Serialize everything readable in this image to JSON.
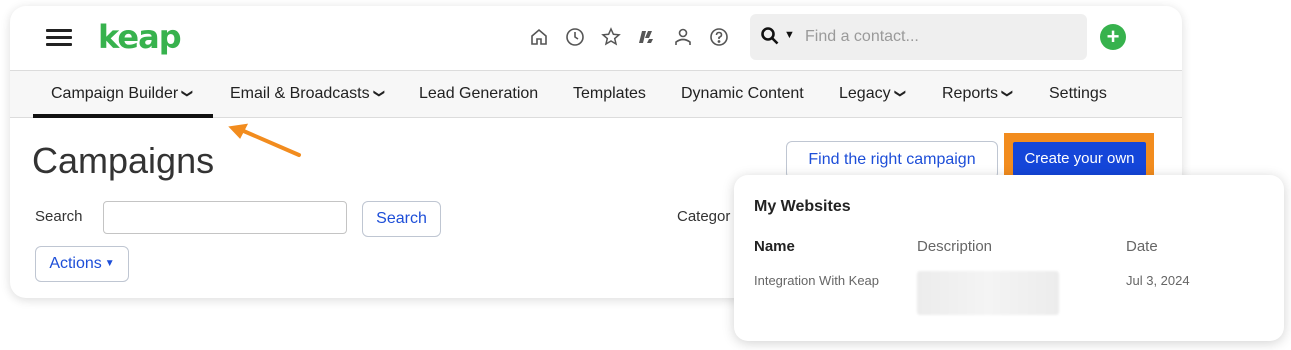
{
  "header": {
    "logo": "keap",
    "icons": [
      "home-icon",
      "clock-icon",
      "star-icon",
      "keap-mark-icon",
      "person-icon",
      "help-icon"
    ],
    "search_placeholder": "Find a contact...",
    "add_label": "+"
  },
  "nav": {
    "items": [
      {
        "label": "Campaign Builder",
        "dropdown": true,
        "active": true
      },
      {
        "label": "Email & Broadcasts",
        "dropdown": true
      },
      {
        "label": "Lead Generation",
        "dropdown": false
      },
      {
        "label": "Templates",
        "dropdown": false
      },
      {
        "label": "Dynamic Content",
        "dropdown": false
      },
      {
        "label": "Legacy",
        "dropdown": true
      },
      {
        "label": "Reports",
        "dropdown": true
      },
      {
        "label": "Settings",
        "dropdown": false
      }
    ]
  },
  "main": {
    "title": "Campaigns",
    "find_button": "Find the right campaign",
    "create_button": "Create your own",
    "search_label": "Search",
    "search_button": "Search",
    "category_label": "Categor",
    "actions_button": "Actions"
  },
  "panel": {
    "title": "My Websites",
    "columns": [
      "Name",
      "Description",
      "Date"
    ],
    "rows": [
      {
        "name": "Integration With Keap",
        "description": "",
        "date": "Jul 3, 2024"
      }
    ]
  },
  "colors": {
    "brand_green": "#37b24d",
    "link_blue": "#1d4ed8",
    "primary_blue": "#1446d9",
    "highlight_orange": "#f28c1e"
  }
}
